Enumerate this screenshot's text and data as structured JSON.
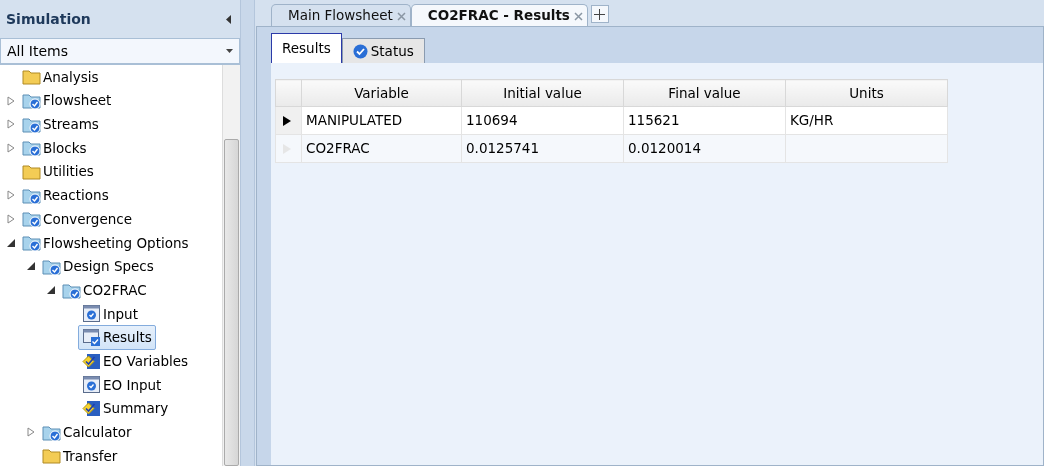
{
  "sidebar": {
    "title": "Simulation",
    "filter": "All Items",
    "tree": [
      {
        "label": "Analysis",
        "kind": "folder"
      },
      {
        "label": "Flowsheet",
        "kind": "folder-check",
        "expanded": false
      },
      {
        "label": "Streams",
        "kind": "folder-check",
        "expanded": false
      },
      {
        "label": "Blocks",
        "kind": "folder-check",
        "expanded": false
      },
      {
        "label": "Utilities",
        "kind": "folder"
      },
      {
        "label": "Reactions",
        "kind": "folder-check",
        "expanded": false
      },
      {
        "label": "Convergence",
        "kind": "folder-check",
        "expanded": false
      },
      {
        "label": "Flowsheeting Options",
        "kind": "folder-check",
        "expanded": true,
        "children": [
          {
            "label": "Design Specs",
            "kind": "folder-check",
            "expanded": true,
            "children": [
              {
                "label": "CO2FRAC",
                "kind": "folder-check",
                "expanded": true,
                "children": [
                  {
                    "label": "Input",
                    "kind": "form",
                    "selected": false
                  },
                  {
                    "label": "Results",
                    "kind": "results",
                    "selected": true
                  },
                  {
                    "label": "EO Variables",
                    "kind": "diamond",
                    "selected": false
                  },
                  {
                    "label": "EO Input",
                    "kind": "form",
                    "selected": false
                  },
                  {
                    "label": "Summary",
                    "kind": "diamond",
                    "selected": false
                  }
                ]
              }
            ]
          },
          {
            "label": "Calculator",
            "kind": "folder-check",
            "expanded": false
          },
          {
            "label": "Transfer",
            "kind": "folder"
          }
        ]
      }
    ]
  },
  "doc_tabs": [
    {
      "label": "Main Flowsheet",
      "selected": false
    },
    {
      "label": "CO2FRAC - Results",
      "selected": true
    }
  ],
  "sub_tabs": [
    {
      "label": "Results",
      "selected": true,
      "kind": "plain"
    },
    {
      "label": "Status",
      "selected": false,
      "kind": "check"
    }
  ],
  "table": {
    "columns": [
      "Variable",
      "Initial value",
      "Final value",
      "Units"
    ],
    "rows": [
      {
        "current": true,
        "cells": [
          "MANIPULATED",
          "110694",
          "115621",
          "KG/HR"
        ]
      },
      {
        "current": false,
        "cells": [
          "CO2FRAC",
          "0.0125741",
          "0.0120014",
          null
        ]
      }
    ]
  }
}
